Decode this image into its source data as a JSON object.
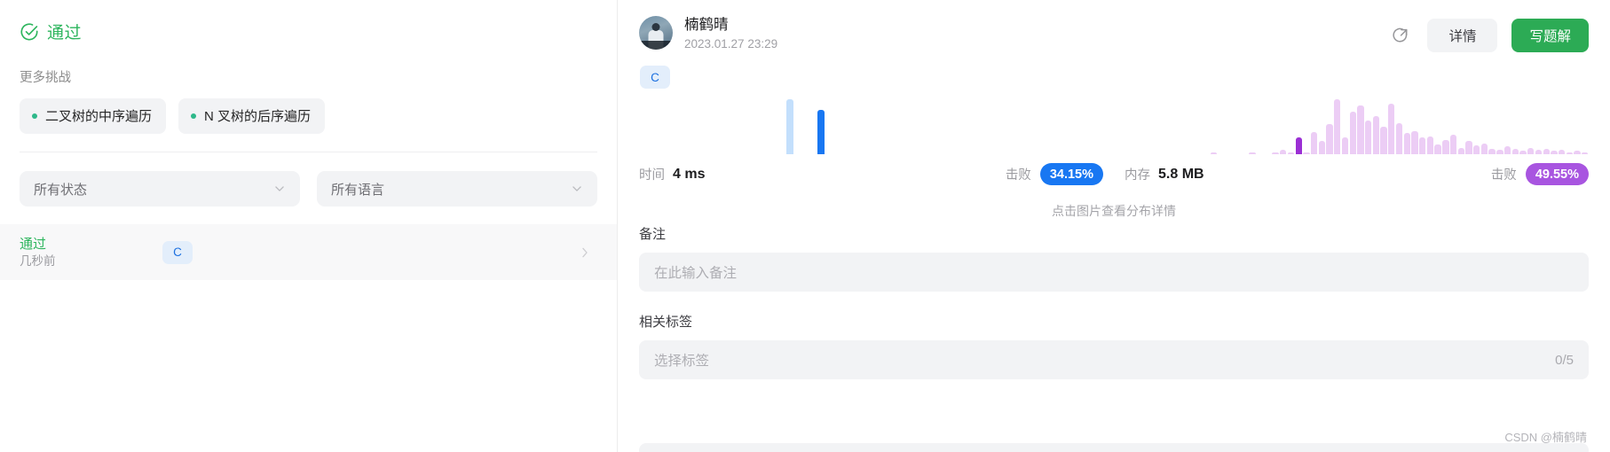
{
  "left": {
    "status": {
      "icon": "check-circle-icon",
      "text": "通过",
      "color": "#2db55d"
    },
    "more_title": "更多挑战",
    "chips": [
      {
        "label": "二叉树的中序遍历"
      },
      {
        "label": "N 叉树的后序遍历"
      }
    ],
    "filters": [
      {
        "label": "所有状态",
        "icon": "chevron-down-icon"
      },
      {
        "label": "所有语言",
        "icon": "chevron-down-icon"
      }
    ],
    "submission": {
      "status": "通过",
      "time": "几秒前",
      "language": "C",
      "arrow_icon": "chevron-right-icon"
    }
  },
  "right": {
    "user": {
      "name": "楠鹤晴",
      "timestamp": "2023.01.27 23:29",
      "avatar": "user-avatar"
    },
    "actions": {
      "share_icon": "share-icon",
      "detail_label": "详情",
      "write_solution_label": "写题解"
    },
    "language_tag": "C",
    "metrics": {
      "time": {
        "label": "时间",
        "value": "4 ms",
        "beat_label": "击败",
        "beat_value": "34.15%",
        "color": "#1877f2"
      },
      "memory": {
        "label": "内存",
        "value": "5.8 MB",
        "beat_label": "击败",
        "beat_value": "49.55%",
        "color": "#a855e0"
      }
    },
    "chart_hint": "点击图片查看分布详情",
    "note": {
      "label": "备注",
      "placeholder": "在此输入备注"
    },
    "tags": {
      "label": "相关标签",
      "placeholder": "选择标签",
      "counter": "0/5"
    },
    "watermark": "CSDN @楠鹤晴"
  },
  "chart_data": [
    {
      "type": "bar",
      "name": "time-distribution",
      "title": "时间分布",
      "xlabel": "",
      "ylabel": "",
      "series_color": "#c3dffc",
      "highlight_color": "#1877f2",
      "highlight_index": 23,
      "values": [
        0,
        0,
        0,
        0,
        0,
        0,
        0,
        0,
        0,
        0,
        0,
        0,
        0,
        0,
        0,
        0,
        0,
        0,
        0,
        64,
        0,
        0,
        0,
        52,
        0,
        0,
        0,
        0,
        0,
        0,
        0,
        0,
        0,
        0,
        0,
        0,
        0,
        0,
        0,
        0,
        0,
        0,
        0,
        0,
        0,
        0,
        0,
        0,
        0,
        0,
        0,
        0,
        0,
        0,
        0,
        0,
        0,
        0,
        0,
        0
      ]
    },
    {
      "type": "bar",
      "name": "memory-distribution",
      "title": "内存分布",
      "xlabel": "",
      "ylabel": "",
      "series_color": "#eccdf5",
      "highlight_color": "#9b2fd4",
      "highlight_index": 22,
      "values": [
        0,
        0,
        0,
        0,
        0,
        0,
        0,
        0,
        0,
        0,
        0,
        3,
        0,
        0,
        0,
        0,
        2,
        0,
        0,
        4,
        8,
        2,
        30,
        3,
        40,
        24,
        55,
        100,
        30,
        78,
        88,
        62,
        70,
        50,
        92,
        56,
        38,
        42,
        30,
        32,
        18,
        26,
        36,
        12,
        24,
        16,
        20,
        10,
        8,
        14,
        10,
        6,
        12,
        8,
        10,
        6,
        8,
        4,
        6,
        3
      ]
    }
  ]
}
